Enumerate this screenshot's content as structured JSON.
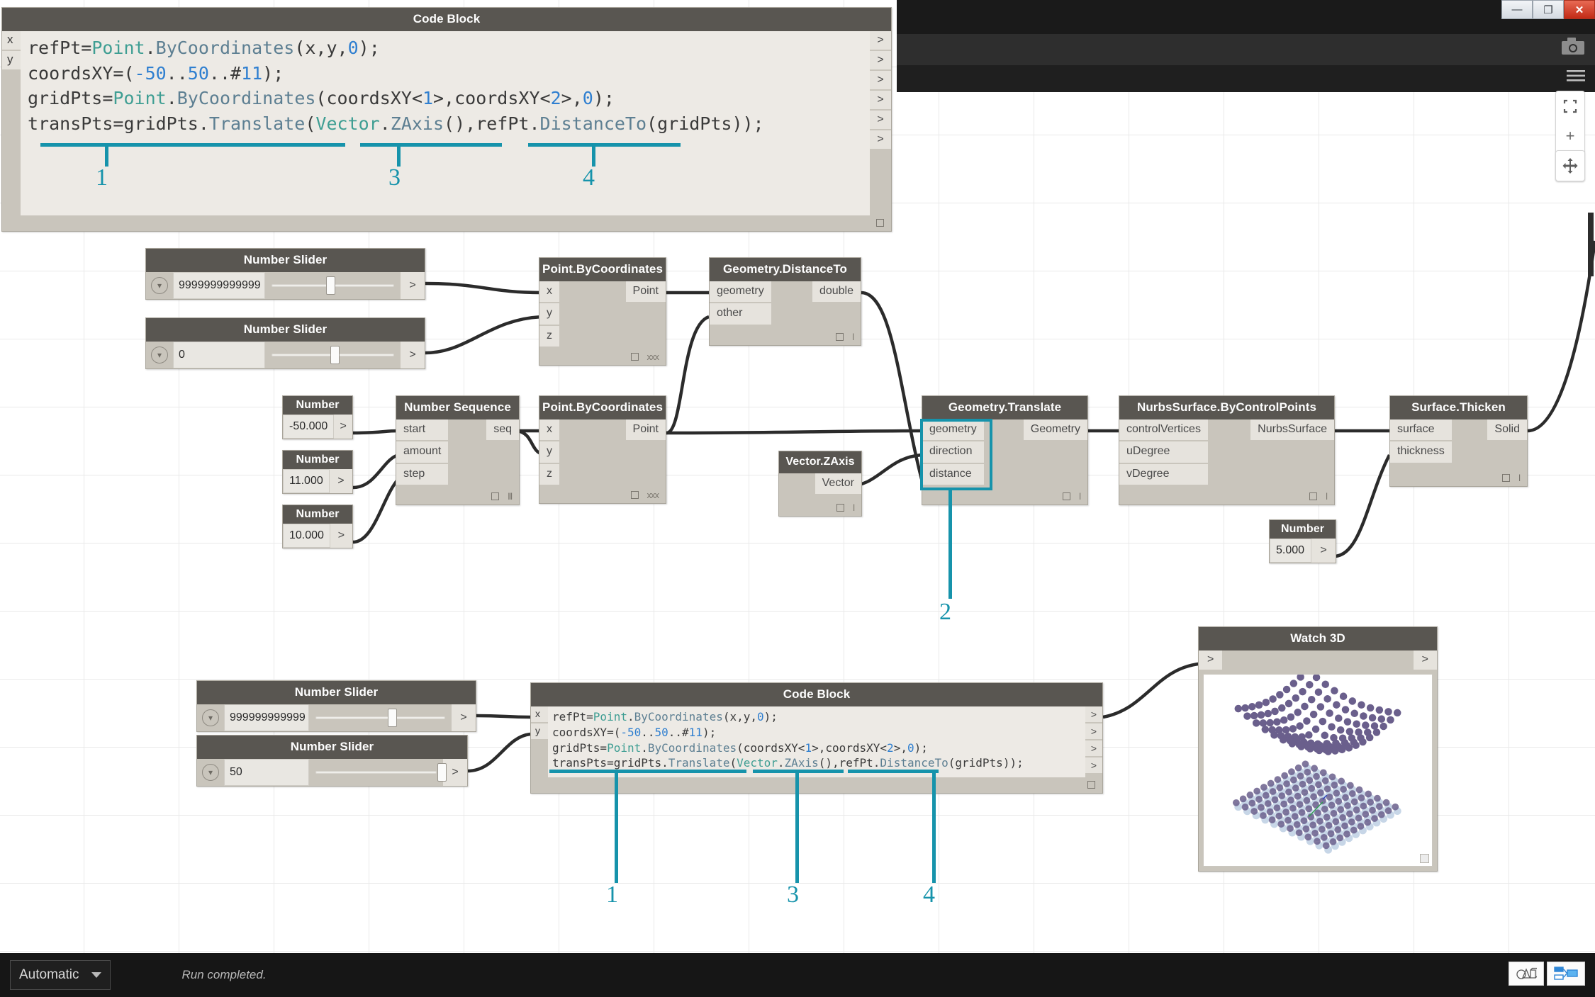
{
  "window": {
    "minimize_label": "—",
    "restore_label": "❐",
    "close_label": "✕"
  },
  "toolbar": {
    "camera_icon": "camera-icon",
    "menu_icon": "hamburger-icon"
  },
  "navigation": {
    "fit_label": "⛶",
    "zoom_in_label": "+",
    "zoom_out_label": "–",
    "pan_label": "✥"
  },
  "statusbar": {
    "run_mode": "Automatic",
    "run_status": "Run completed."
  },
  "bottom_icons": {
    "geometry_view_icon": "geometry-view-icon",
    "graph_view_icon": "graph-view-icon"
  },
  "code_block": {
    "title": "Code Block",
    "inputs": [
      "x",
      "y"
    ],
    "output_marker": ">",
    "output_count": 6,
    "lines": [
      [
        {
          "t": "refPt=",
          "c": "plain"
        },
        {
          "t": "Point",
          "c": "type"
        },
        {
          "t": ".",
          "c": "plain"
        },
        {
          "t": "ByCoordinates",
          "c": "method"
        },
        {
          "t": "(x,y,",
          "c": "plain"
        },
        {
          "t": "0",
          "c": "num"
        },
        {
          "t": ");",
          "c": "plain"
        }
      ],
      [
        {
          "t": "coordsXY=(",
          "c": "plain"
        },
        {
          "t": "-50",
          "c": "num"
        },
        {
          "t": "..",
          "c": "plain"
        },
        {
          "t": "50",
          "c": "num"
        },
        {
          "t": "..#",
          "c": "plain"
        },
        {
          "t": "11",
          "c": "num"
        },
        {
          "t": ");",
          "c": "plain"
        }
      ],
      [
        {
          "t": "gridPts=",
          "c": "plain"
        },
        {
          "t": "Point",
          "c": "type"
        },
        {
          "t": ".",
          "c": "plain"
        },
        {
          "t": "ByCoordinates",
          "c": "method"
        },
        {
          "t": "(coordsXY<",
          "c": "plain"
        },
        {
          "t": "1",
          "c": "num"
        },
        {
          "t": ">,coordsXY<",
          "c": "plain"
        },
        {
          "t": "2",
          "c": "num"
        },
        {
          "t": ">,",
          "c": "plain"
        },
        {
          "t": "0",
          "c": "num"
        },
        {
          "t": ");",
          "c": "plain"
        }
      ],
      [
        {
          "t": "transPts=gridPts.",
          "c": "plain"
        },
        {
          "t": "Translate",
          "c": "method"
        },
        {
          "t": "(",
          "c": "plain"
        },
        {
          "t": "Vector",
          "c": "type"
        },
        {
          "t": ".",
          "c": "plain"
        },
        {
          "t": "ZAxis",
          "c": "method"
        },
        {
          "t": "(),refPt.",
          "c": "plain"
        },
        {
          "t": "DistanceTo",
          "c": "method"
        },
        {
          "t": "(gridPts));",
          "c": "plain"
        }
      ]
    ],
    "plain_text": "refPt=Point.ByCoordinates(x,y,0);\ncoordsXY=(-50..50..#11);\ngridPts=Point.ByCoordinates(coordsXY<1>,coordsXY<2>,0);\ntransPts=gridPts.Translate(Vector.ZAxis(),refPt.DistanceTo(gridPts));"
  },
  "annotations": {
    "top": [
      {
        "label": "1"
      },
      {
        "label": "3"
      },
      {
        "label": "4"
      }
    ],
    "translate_callout": {
      "label": "2"
    },
    "bottom": [
      {
        "label": "1"
      },
      {
        "label": "3"
      },
      {
        "label": "4"
      }
    ],
    "color": "#1693ab"
  },
  "sliders": [
    {
      "title": "Number Slider",
      "value": "9999999999999",
      "thumb_pct": 45,
      "output_marker": ">"
    },
    {
      "title": "Number Slider",
      "value": "0",
      "thumb_pct": 48,
      "output_marker": ">"
    },
    {
      "title": "Number Slider",
      "value": "999999999999",
      "thumb_pct": 55,
      "output_marker": ">"
    },
    {
      "title": "Number Slider",
      "value": "50",
      "thumb_pct": 97,
      "output_marker": ">"
    }
  ],
  "numbers": [
    {
      "title": "Number",
      "value": "-50.000",
      "output_marker": ">"
    },
    {
      "title": "Number",
      "value": "11.000",
      "output_marker": ">"
    },
    {
      "title": "Number",
      "value": "10.000",
      "output_marker": ">"
    },
    {
      "title": "Number",
      "value": "5.000",
      "output_marker": ">"
    }
  ],
  "nodes": [
    {
      "id": "point-bycoordinates-1",
      "title": "Point.ByCoordinates",
      "inputs": [
        "x",
        "y",
        "z"
      ],
      "outputs": [
        "Point"
      ],
      "footer_glyph": "xxx"
    },
    {
      "id": "geometry-distanceto",
      "title": "Geometry.DistanceTo",
      "inputs": [
        "geometry",
        "other"
      ],
      "outputs": [
        "double"
      ],
      "footer_glyph": "l"
    },
    {
      "id": "number-sequence",
      "title": "Number Sequence",
      "inputs": [
        "start",
        "amount",
        "step"
      ],
      "outputs": [
        "seq"
      ],
      "footer_glyph": "lll"
    },
    {
      "id": "point-bycoordinates-2",
      "title": "Point.ByCoordinates",
      "inputs": [
        "x",
        "y",
        "z"
      ],
      "outputs": [
        "Point"
      ],
      "footer_glyph": "xxx"
    },
    {
      "id": "vector-zaxis",
      "title": "Vector.ZAxis",
      "inputs": [],
      "outputs": [
        "Vector"
      ],
      "footer_glyph": "l"
    },
    {
      "id": "geometry-translate",
      "title": "Geometry.Translate",
      "inputs": [
        "geometry",
        "direction",
        "distance"
      ],
      "outputs": [
        "Geometry"
      ],
      "footer_glyph": "l"
    },
    {
      "id": "nurbssurface-bycontrolpoints",
      "title": "NurbsSurface.ByControlPoints",
      "inputs": [
        "controlVertices",
        "uDegree",
        "vDegree"
      ],
      "outputs": [
        "NurbsSurface"
      ],
      "footer_glyph": "l"
    },
    {
      "id": "surface-thicken",
      "title": "Surface.Thicken",
      "inputs": [
        "surface",
        "thickness"
      ],
      "outputs": [
        "Solid"
      ],
      "footer_glyph": "l"
    }
  ],
  "watch3d": {
    "title": "Watch 3D",
    "input_marker": ">",
    "output_marker": ">",
    "preview_description": "point-grid-surface-preview"
  }
}
